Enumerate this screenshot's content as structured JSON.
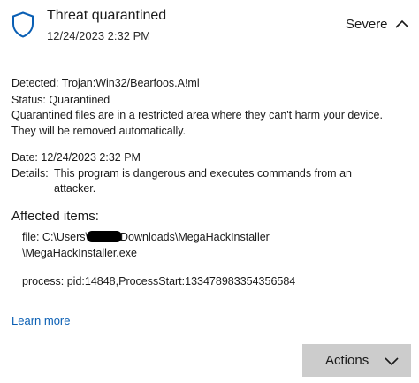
{
  "header": {
    "title": "Threat quarantined",
    "timestamp": "12/24/2023 2:32 PM",
    "severity": "Severe",
    "icon": "shield-icon"
  },
  "details": {
    "detected_label": "Detected:",
    "detected_value": "Trojan:Win32/Bearfoos.A!ml",
    "status_label": "Status:",
    "status_value": "Quarantined",
    "status_note_line1": "Quarantined files are in a restricted area where they can't harm your device.",
    "status_note_line2": "They will be removed automatically.",
    "date_label": "Date:",
    "date_value": "12/24/2023 2:32 PM",
    "details_label": "Details:",
    "details_line1": "This program is dangerous and executes commands from an",
    "details_line2": "attacker."
  },
  "affected": {
    "heading": "Affected items:",
    "file_prefix": "file: C:\\Users\\",
    "file_suffix": "Downloads\\MegaHackInstaller",
    "file_line2": "\\MegaHackInstaller.exe",
    "process": "process: pid:14848,ProcessStart:133478983354356584"
  },
  "footer": {
    "learn_more": "Learn more",
    "actions_label": "Actions"
  }
}
